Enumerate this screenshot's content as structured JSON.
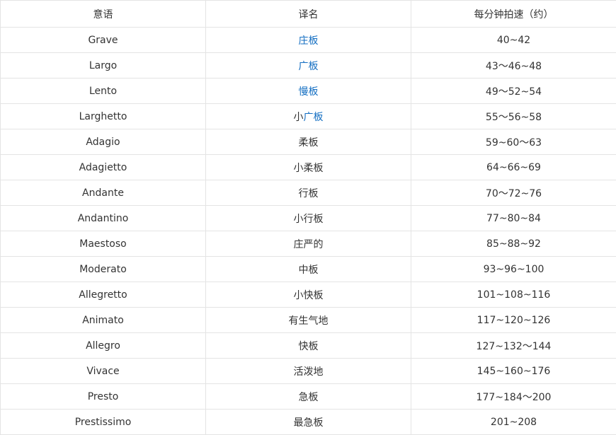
{
  "table": {
    "headers": [
      "意语",
      "译名",
      "每分钟拍速（约）"
    ],
    "rows": [
      {
        "italian": "Grave",
        "name": "庄板",
        "bpm": "40~42",
        "link": true
      },
      {
        "italian": "Largo",
        "name": "广板",
        "bpm": "43～46~48",
        "link": true
      },
      {
        "italian": "Lento",
        "name": "慢板",
        "bpm": "49～52~54",
        "link": true
      },
      {
        "italian": "Larghetto",
        "name_prefix": "小",
        "name_link": "广板",
        "bpm": "55～56~58",
        "link": false
      },
      {
        "italian": "Adagio",
        "name": "柔板",
        "bpm": "59~60～63",
        "link": false
      },
      {
        "italian": "Adagietto",
        "name": "小柔板",
        "bpm": "64~66~69",
        "link": false
      },
      {
        "italian": "Andante",
        "name": "行板",
        "bpm": "70～72~76",
        "link": false
      },
      {
        "italian": "Andantino",
        "name": "小行板",
        "bpm": "77~80~84",
        "link": false
      },
      {
        "italian": "Maestoso",
        "name": "庄严的",
        "bpm": "85~88~92",
        "link": false
      },
      {
        "italian": "Moderato",
        "name": "中板",
        "bpm": "93~96~100",
        "link": false
      },
      {
        "italian": "Allegretto",
        "name": "小快板",
        "bpm": "101~108~116",
        "link": false
      },
      {
        "italian": "Animato",
        "name": "有生气地",
        "bpm": "117~120~126",
        "link": false
      },
      {
        "italian": "Allegro",
        "name": "快板",
        "bpm": "127~132～144",
        "link": false
      },
      {
        "italian": "Vivace",
        "name": "活泼地",
        "bpm": "145~160~176",
        "link": false
      },
      {
        "italian": "Presto",
        "name": "急板",
        "bpm": "177~184～200",
        "link": false
      },
      {
        "italian": "Prestissimo",
        "name": "最急板",
        "bpm": "201~208",
        "link": false
      }
    ]
  },
  "colors": {
    "link": "#136ec2",
    "text": "#333333",
    "border": "#e4e4e4"
  }
}
